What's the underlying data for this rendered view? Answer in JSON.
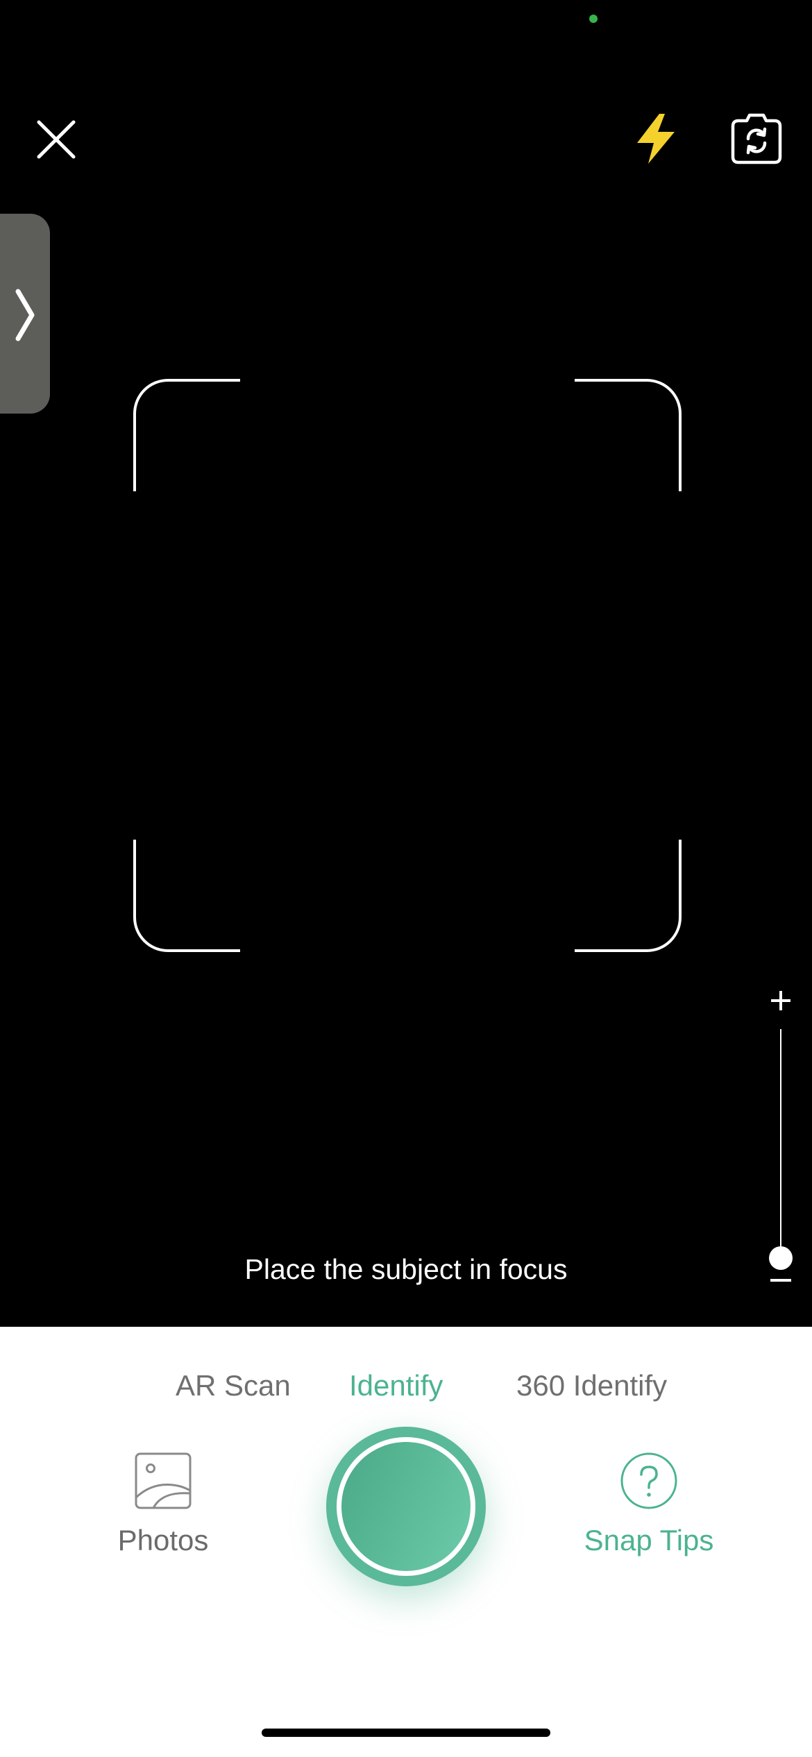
{
  "camera": {
    "focus_hint": "Place the subject in focus",
    "zoom_level": 0
  },
  "toolbar": {
    "close_icon": "close-icon",
    "flash_icon": "flash-icon",
    "flip_icon": "camera-flip-icon",
    "flash_color": "#f5d12e"
  },
  "side_handle": {
    "icon": "chevron-right-icon"
  },
  "modes": [
    {
      "label": "AR Scan",
      "active": false
    },
    {
      "label": "Identify",
      "active": true
    },
    {
      "label": "360 Identify",
      "active": false
    }
  ],
  "bottom": {
    "photos_label": "Photos",
    "tips_label": "Snap Tips",
    "accent_color": "#4bb38f"
  }
}
